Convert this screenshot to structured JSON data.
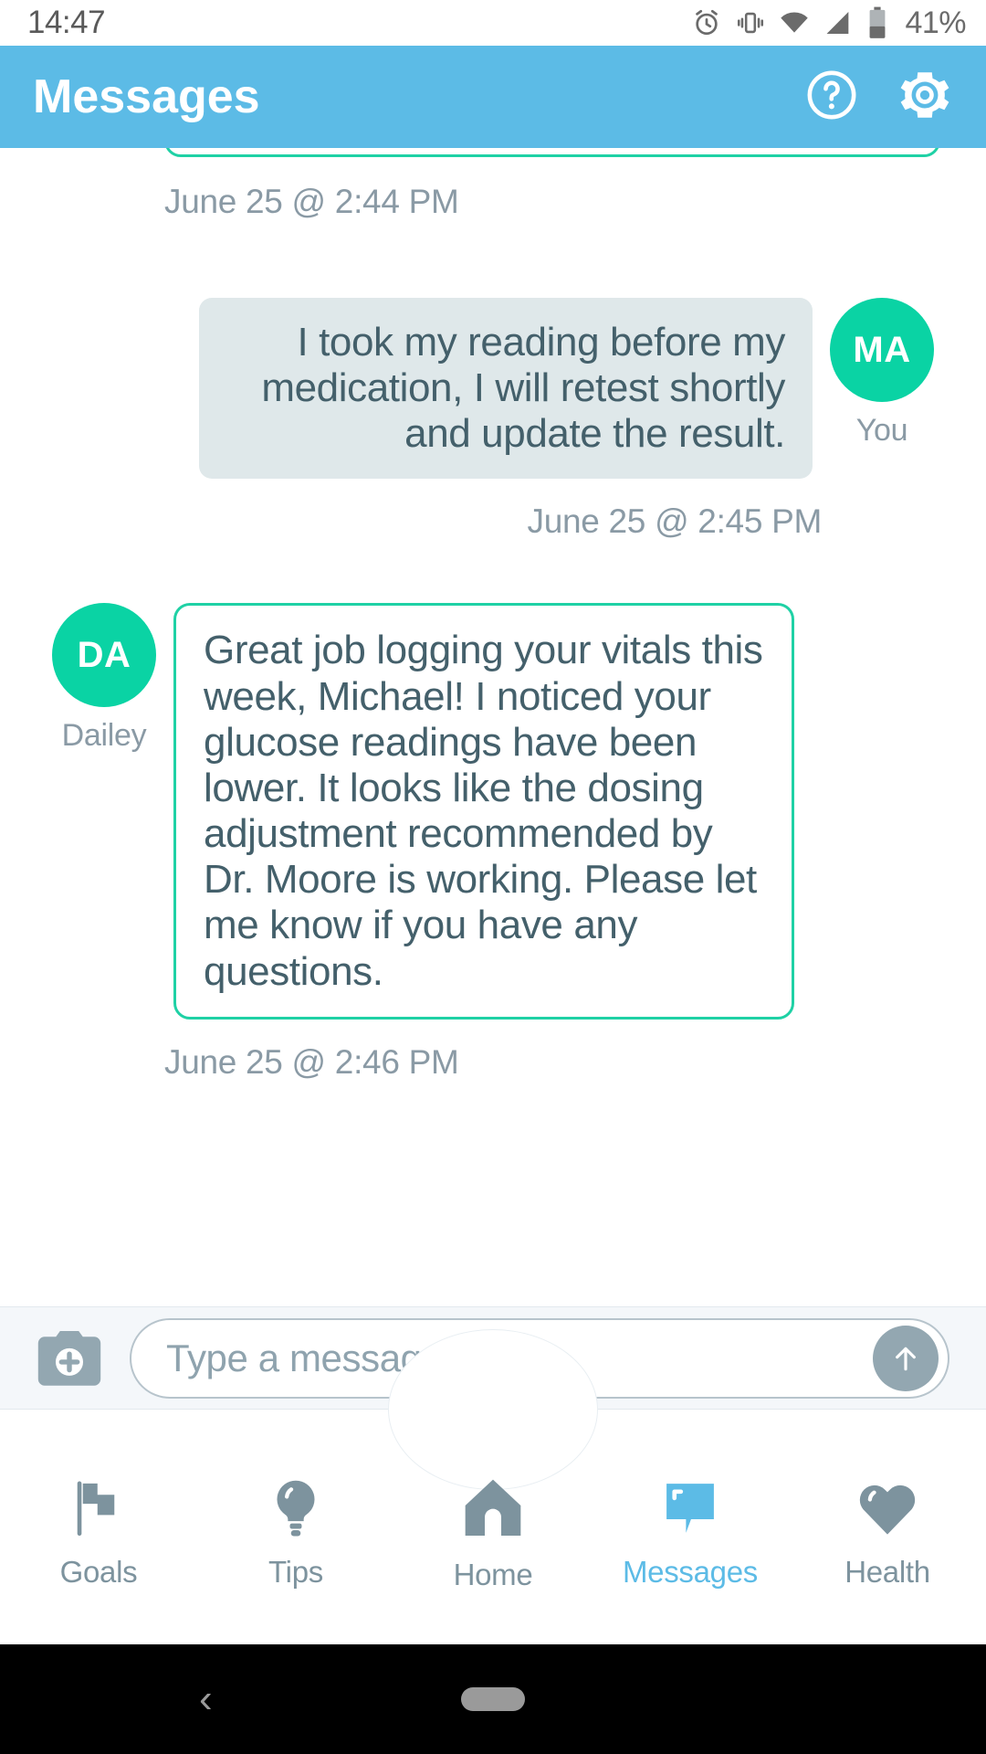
{
  "status_bar": {
    "time": "14:47",
    "battery_percent": "41%",
    "icons": [
      "alarm-icon",
      "vibrate-icon",
      "wifi-icon",
      "signal-icon",
      "battery-icon"
    ]
  },
  "header": {
    "title": "Messages",
    "background_color": "#5cbbe6",
    "help_icon": "help-circle-icon",
    "settings_icon": "gear-icon"
  },
  "conversation": {
    "partial_top_bubble": "",
    "timestamp_top": "June 25 @ 2:44 PM",
    "messages": [
      {
        "sender": "You",
        "initials": "MA",
        "side": "me",
        "text": "I took my reading before my medication, I will retest shortly and update the result.",
        "timestamp": "June 25 @ 2:45 PM",
        "avatar_color": "#0ad3a4"
      },
      {
        "sender": "Dailey",
        "initials": "DA",
        "side": "them",
        "text": "Great job logging your vitals this week, Michael! I noticed your glucose readings have been lower. It looks like the dosing adjustment recommended by Dr. Moore is working. Please let me know if you have any questions.",
        "timestamp": "June 25 @ 2:46 PM",
        "avatar_color": "#0ad3a4",
        "border_color": "#1fd1a5"
      }
    ]
  },
  "composer": {
    "camera_icon": "camera-add-icon",
    "placeholder": "Type a message...",
    "value": "",
    "send_icon": "arrow-up-icon"
  },
  "bottom_nav": {
    "active": "Messages",
    "active_color": "#5cbbe6",
    "inactive_color": "#7d939e",
    "items": [
      {
        "label": "Goals",
        "icon": "flag-icon"
      },
      {
        "label": "Tips",
        "icon": "lightbulb-icon"
      },
      {
        "label": "Home",
        "icon": "home-icon"
      },
      {
        "label": "Messages",
        "icon": "chat-bubble-icon"
      },
      {
        "label": "Health",
        "icon": "heart-icon"
      }
    ]
  },
  "system_nav": {
    "back_icon": "chevron-left-icon",
    "home_pill": "home-pill-indicator"
  }
}
